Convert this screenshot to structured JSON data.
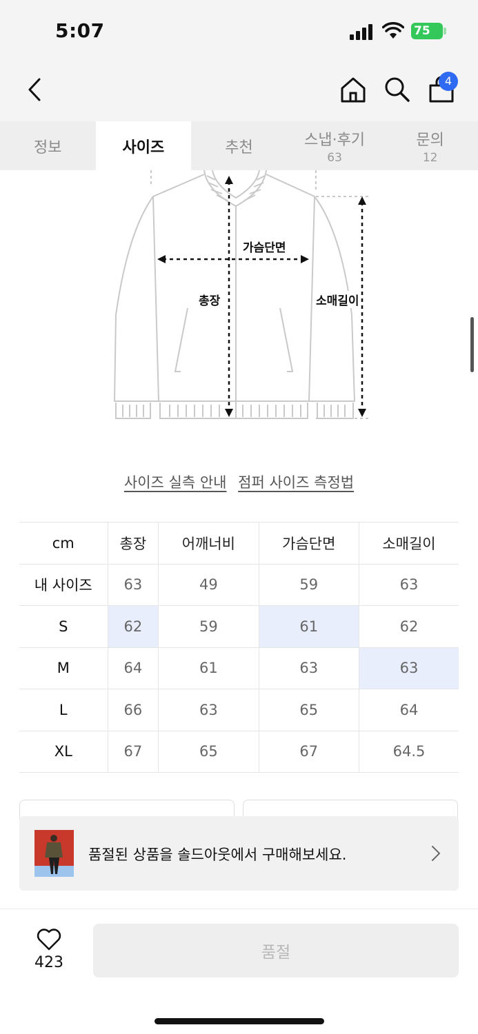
{
  "status_bar": {
    "time": "5:07",
    "battery": "75",
    "icons": [
      "signal-icon",
      "wifi-icon",
      "battery-icon"
    ]
  },
  "nav": {
    "back_icon": "chevron-left-icon",
    "home_icon": "home-icon",
    "search_icon": "search-icon",
    "cart_icon": "shopping-bag-icon",
    "cart_count": "4"
  },
  "tabs": [
    {
      "label": "정보",
      "count": ""
    },
    {
      "label": "사이즈",
      "count": "",
      "active": true
    },
    {
      "label": "추천",
      "count": ""
    },
    {
      "label": "스냅·후기",
      "count": "63"
    },
    {
      "label": "문의",
      "count": "12"
    }
  ],
  "diagram": {
    "labels": {
      "chest": "가슴단면",
      "total_length": "총장",
      "sleeve": "소매길이"
    }
  },
  "links": {
    "size_guide": "사이즈 실측 안내",
    "measure_guide": "점퍼 사이즈 측정법"
  },
  "size_table": {
    "headers": [
      "cm",
      "총장",
      "어깨너비",
      "가슴단면",
      "소매길이"
    ],
    "rows": [
      {
        "label": "내 사이즈",
        "values": [
          "63",
          "49",
          "59",
          "63"
        ]
      },
      {
        "label": "S",
        "values": [
          "62",
          "59",
          "61",
          "62"
        ]
      },
      {
        "label": "M",
        "values": [
          "64",
          "61",
          "63",
          "63"
        ]
      },
      {
        "label": "L",
        "values": [
          "66",
          "63",
          "65",
          "64"
        ]
      },
      {
        "label": "XL",
        "values": [
          "67",
          "65",
          "67",
          "64.5"
        ]
      }
    ],
    "highlight_color": "#e8eefc"
  },
  "soldout_banner": {
    "text": "품절된 상품을 솔드아웃에서 구매해보세요.",
    "chevron_icon": "chevron-right-icon"
  },
  "bottom_bar": {
    "like_icon": "heart-icon",
    "like_count": "423",
    "buy_label": "품절"
  },
  "colors": {
    "accent": "#2f6bf2",
    "battery": "#34c759",
    "highlight": "#e8eefc"
  }
}
